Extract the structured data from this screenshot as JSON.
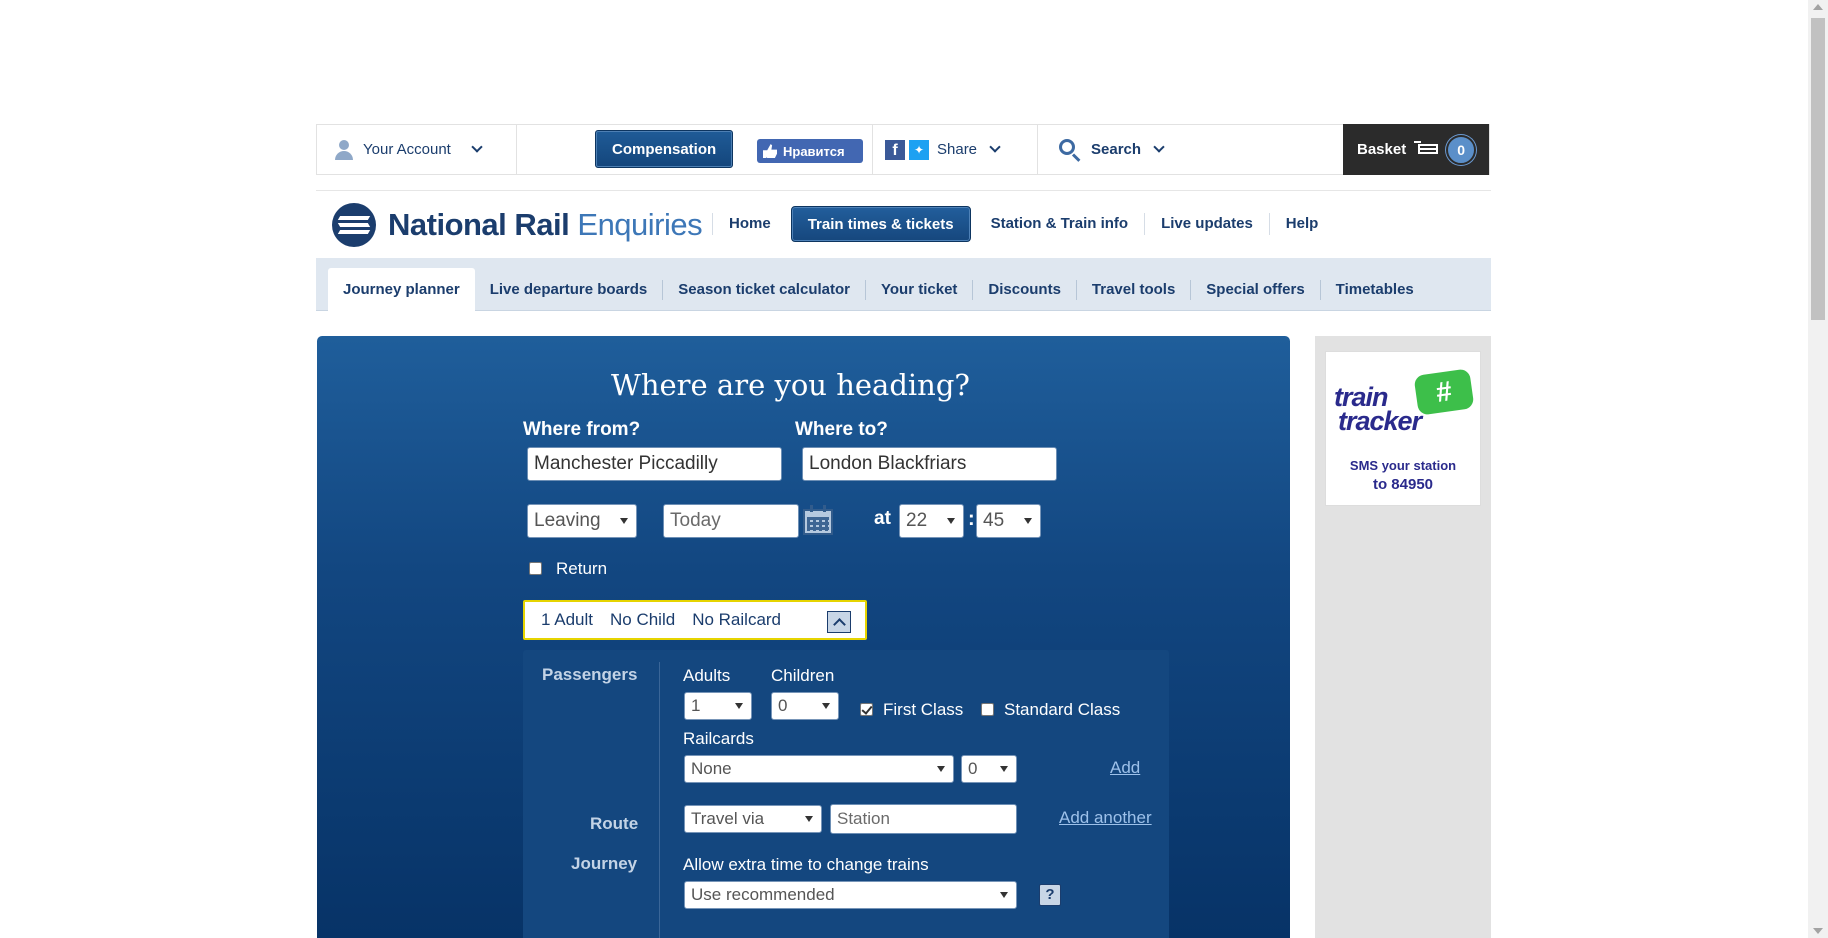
{
  "utility_bar": {
    "account_label": "Your Account",
    "compensation_label": "Compensation",
    "fb_like_label": "Нравится",
    "share_label": "Share",
    "search_label": "Search",
    "basket_label": "Basket",
    "basket_count": "0"
  },
  "logo": {
    "word1": "National Rail",
    "word2": "Enquiries"
  },
  "main_nav": [
    {
      "label": "Home",
      "active": false
    },
    {
      "label": "Train times & tickets",
      "active": true
    },
    {
      "label": "Station & Train info",
      "active": false
    },
    {
      "label": "Live updates",
      "active": false
    },
    {
      "label": "Help",
      "active": false
    }
  ],
  "sub_nav": [
    {
      "label": "Journey planner",
      "active": true
    },
    {
      "label": "Live departure boards",
      "active": false
    },
    {
      "label": "Season ticket calculator",
      "active": false
    },
    {
      "label": "Your ticket",
      "active": false
    },
    {
      "label": "Discounts",
      "active": false
    },
    {
      "label": "Travel tools",
      "active": false
    },
    {
      "label": "Special offers",
      "active": false
    },
    {
      "label": "Timetables",
      "active": false
    }
  ],
  "planner": {
    "heading": "Where are you heading?",
    "from_label": "Where from?",
    "from_value": "Manchester Piccadilly",
    "to_label": "Where to?",
    "to_value": "London Blackfriars",
    "leaving_select": "Leaving",
    "date_placeholder": "Today",
    "at_label": "at",
    "hour": "22",
    "minute": "45",
    "return_label": "Return",
    "return_checked": false,
    "passenger_summary": {
      "adults": "1 Adult",
      "children": "No Child",
      "railcard": "No Railcard"
    },
    "options": {
      "passengers_label": "Passengers",
      "adults_label": "Adults",
      "adults_value": "1",
      "children_label": "Children",
      "children_value": "0",
      "first_class_label": "First Class",
      "first_class_checked": true,
      "standard_class_label": "Standard Class",
      "standard_class_checked": false,
      "railcards_label": "Railcards",
      "railcard_value": "None",
      "railcard_count": "0",
      "add_label": "Add",
      "route_label": "Route",
      "travel_via_value": "Travel via",
      "station_placeholder": "Station",
      "add_another_label": "Add another",
      "journey_label": "Journey",
      "extra_time_label": "Allow extra time to change trains",
      "extra_time_value": "Use recommended",
      "help_label": "?"
    }
  },
  "ad": {
    "brand_line1": "train",
    "brand_line2": "tracker",
    "hash_symbol": "#",
    "sms_line1": "SMS your station",
    "sms_line2": "to 84950"
  }
}
